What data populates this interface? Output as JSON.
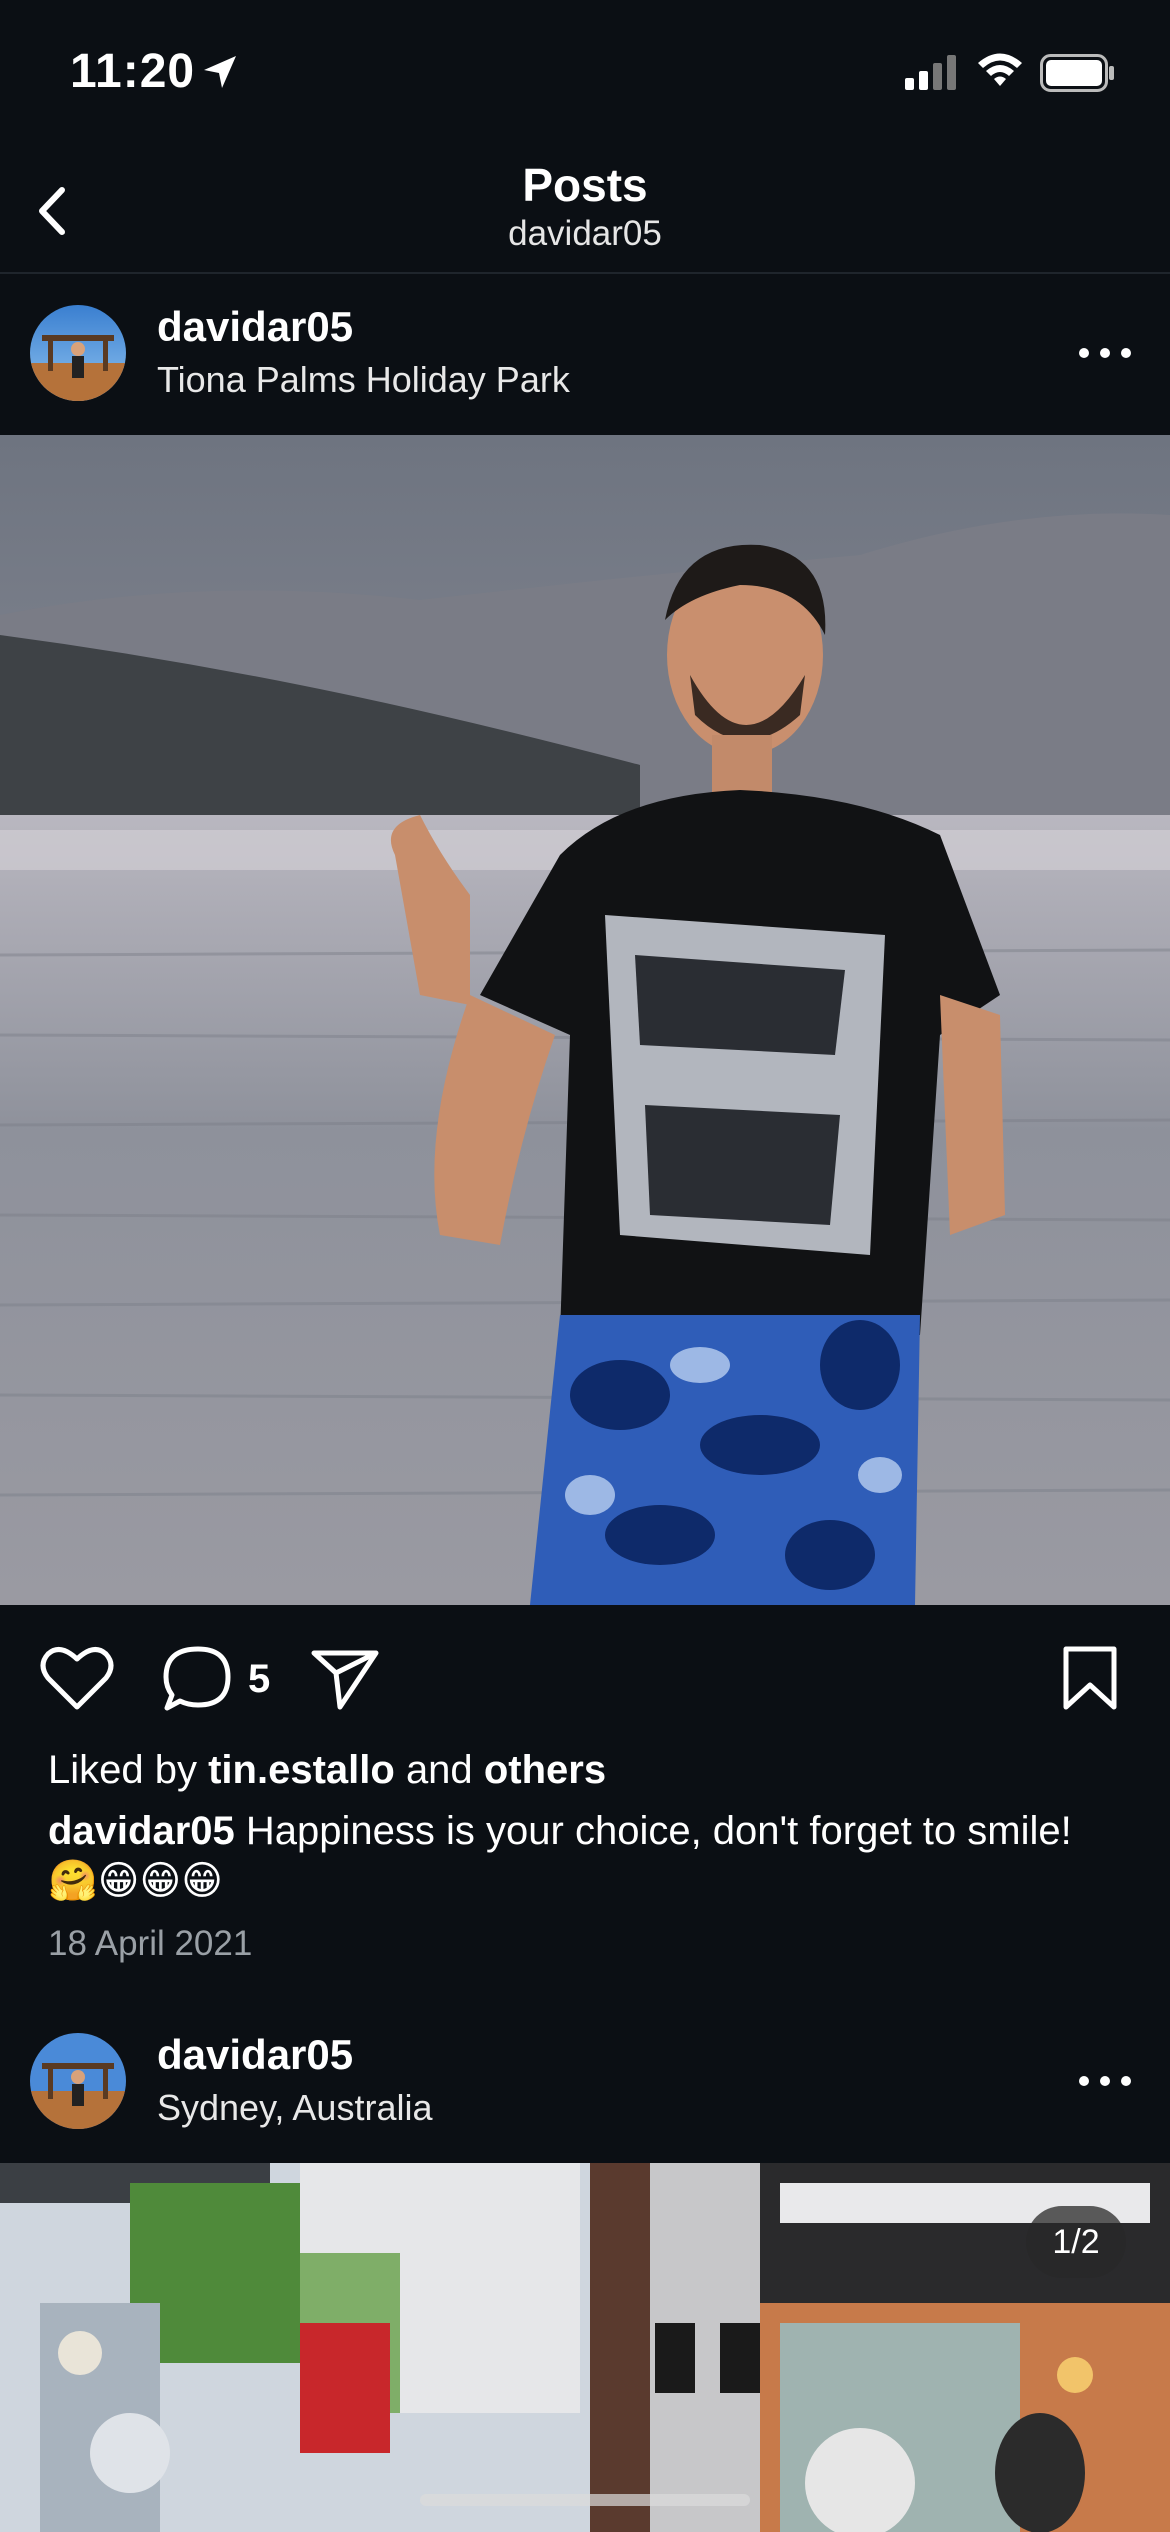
{
  "status_bar": {
    "time": "11:20"
  },
  "header": {
    "title": "Posts",
    "subtitle": "davidar05"
  },
  "posts": [
    {
      "username": "davidar05",
      "location": "Tiona Palms Holiday Park",
      "comment_count": "5",
      "liked_by_prefix": "Liked by",
      "liked_by_user": "tin.estallo",
      "liked_by_and": "and",
      "liked_by_others": "others",
      "caption_user": "davidar05",
      "caption_text": "Happiness is your choice, don't forget to smile! 🤗😁😁😁",
      "date": "18 April 2021"
    },
    {
      "username": "davidar05",
      "location": "Sydney, Australia",
      "carousel_counter": "1/2"
    }
  ],
  "icons": {
    "back": "chevron-left-icon",
    "more": "more-horizontal-icon",
    "like": "heart-icon",
    "comment": "comment-icon",
    "share": "paper-plane-icon",
    "save": "bookmark-icon"
  },
  "colors": {
    "background": "#0b0f14",
    "text": "#ffffff",
    "secondary_text": "#9aa0a6"
  }
}
